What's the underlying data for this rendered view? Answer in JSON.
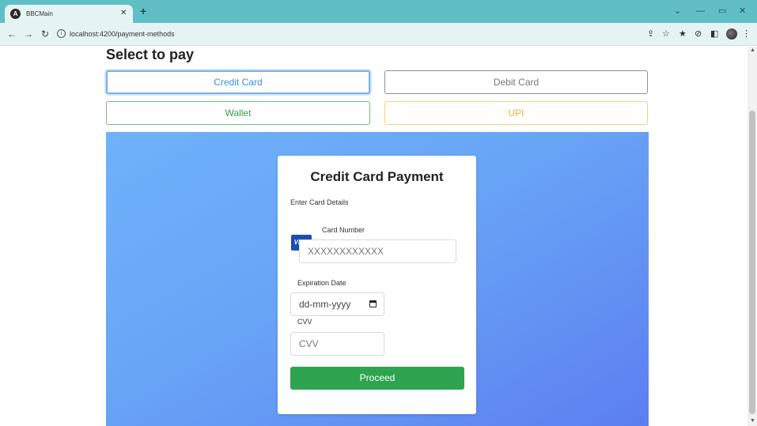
{
  "browser": {
    "tab_title": "BBCMain",
    "tab_favicon": "angular-icon",
    "url": "localhost:4200/payment-methods"
  },
  "page": {
    "heading": "Select to pay",
    "methods": {
      "credit": "Credit Card",
      "debit": "Debit Card",
      "wallet": "Wallet",
      "upi": "UPI"
    },
    "form": {
      "title": "Credit Card Payment",
      "subtitle": "Enter Card Details",
      "card_number_label": "Card Number",
      "card_number_placeholder": "XXXXXXXXXXXX",
      "card_brand": "VISA",
      "expiry_label": "Expiration Date",
      "expiry_placeholder": "dd-mm-yyyy",
      "cvv_label": "CVV",
      "cvv_placeholder": "CVV",
      "proceed_label": "Proceed"
    }
  },
  "colors": {
    "credit_accent": "#3e8ee0",
    "wallet_accent": "#3c9a4d",
    "upi_accent": "#e7b332",
    "proceed_bg": "#2ea44f",
    "panel_gradient_start": "#6fb2fb",
    "panel_gradient_end": "#5c7ff0"
  }
}
